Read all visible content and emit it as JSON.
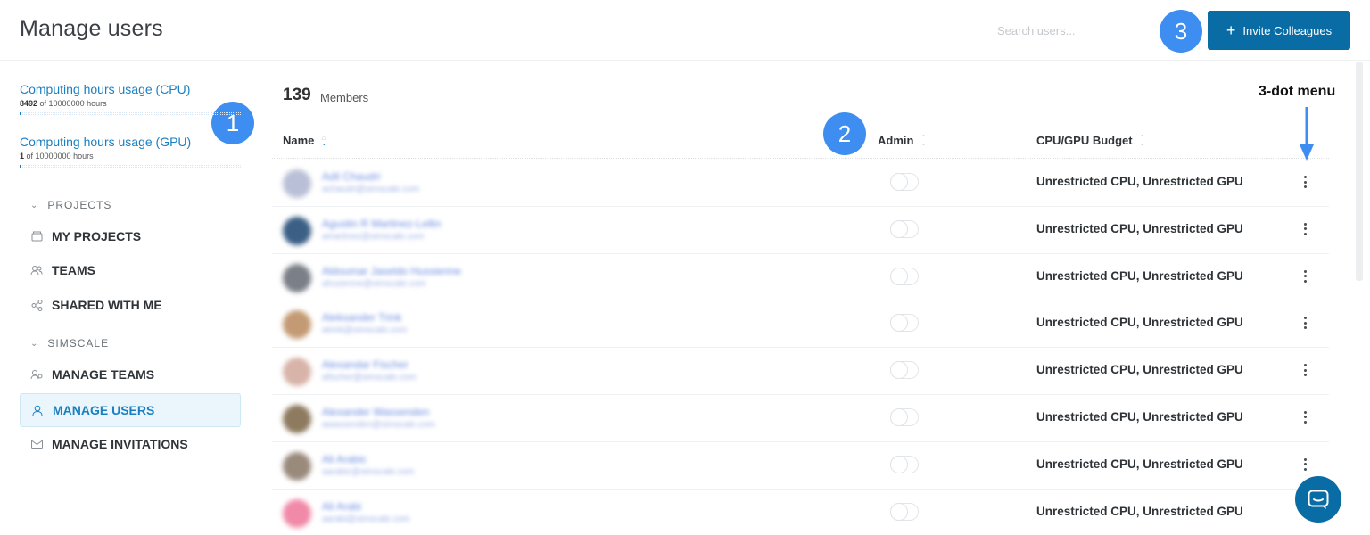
{
  "header": {
    "title": "Manage users",
    "search_placeholder": "Search users...",
    "invite_label": "Invite Colleagues"
  },
  "callouts": {
    "c1": "1",
    "c2": "2",
    "c3": "3"
  },
  "sidebar": {
    "cpu": {
      "title": "Computing hours usage (CPU)",
      "used": "8492",
      "rest": " of 10000000 hours",
      "fraction": 0.000849
    },
    "gpu": {
      "title": "Computing hours usage (GPU)",
      "used": "1",
      "rest": " of 10000000 hours",
      "fraction": 1e-07
    },
    "projects_heading": "PROJECTS",
    "simscale_heading": "SIMSCALE",
    "items": {
      "my_projects": "MY PROJECTS",
      "teams": "TEAMS",
      "shared": "SHARED WITH ME",
      "manage_teams": "MANAGE TEAMS",
      "manage_users": "MANAGE USERS",
      "manage_invitations": "MANAGE INVITATIONS"
    }
  },
  "main": {
    "member_count": "139",
    "member_label": "Members",
    "columns": {
      "name": "Name",
      "admin": "Admin",
      "budget": "CPU/GPU Budget"
    },
    "annotation": "3-dot menu",
    "rows": [
      {
        "name": "Adil Chaudri",
        "email": "achaudri@simscale.com",
        "budget": "Unrestricted CPU, Unrestricted GPU",
        "avatar_color": "#b9bfd6"
      },
      {
        "name": "Agustin R Martinez-Lellin",
        "email": "amartinez@simscale.com",
        "budget": "Unrestricted CPU, Unrestricted GPU",
        "avatar_color": "#3c5f86"
      },
      {
        "name": "Aldoumar Jaseldo Hussienne",
        "email": "ahusienne@simscale.com",
        "budget": "Unrestricted CPU, Unrestricted GPU",
        "avatar_color": "#7a7f88"
      },
      {
        "name": "Aleksander Trink",
        "email": "atrink@simscale.com",
        "budget": "Unrestricted CPU, Unrestricted GPU",
        "avatar_color": "#c49a74"
      },
      {
        "name": "Alexandar Fischer",
        "email": "afischer@simscale.com",
        "budget": "Unrestricted CPU, Unrestricted GPU",
        "avatar_color": "#d7b3a8"
      },
      {
        "name": "Alexander Wassenden",
        "email": "awassenden@simscale.com",
        "budget": "Unrestricted CPU, Unrestricted GPU",
        "avatar_color": "#8e7a5e"
      },
      {
        "name": "Ali Arabic",
        "email": "aarabic@simscale.com",
        "budget": "Unrestricted CPU, Unrestricted GPU",
        "avatar_color": "#9a8a7c"
      },
      {
        "name": "Ali Arabi",
        "email": "aarabi@simscale.com",
        "budget": "Unrestricted CPU, Unrestricted GPU",
        "avatar_color": "#f08aa8"
      }
    ]
  }
}
